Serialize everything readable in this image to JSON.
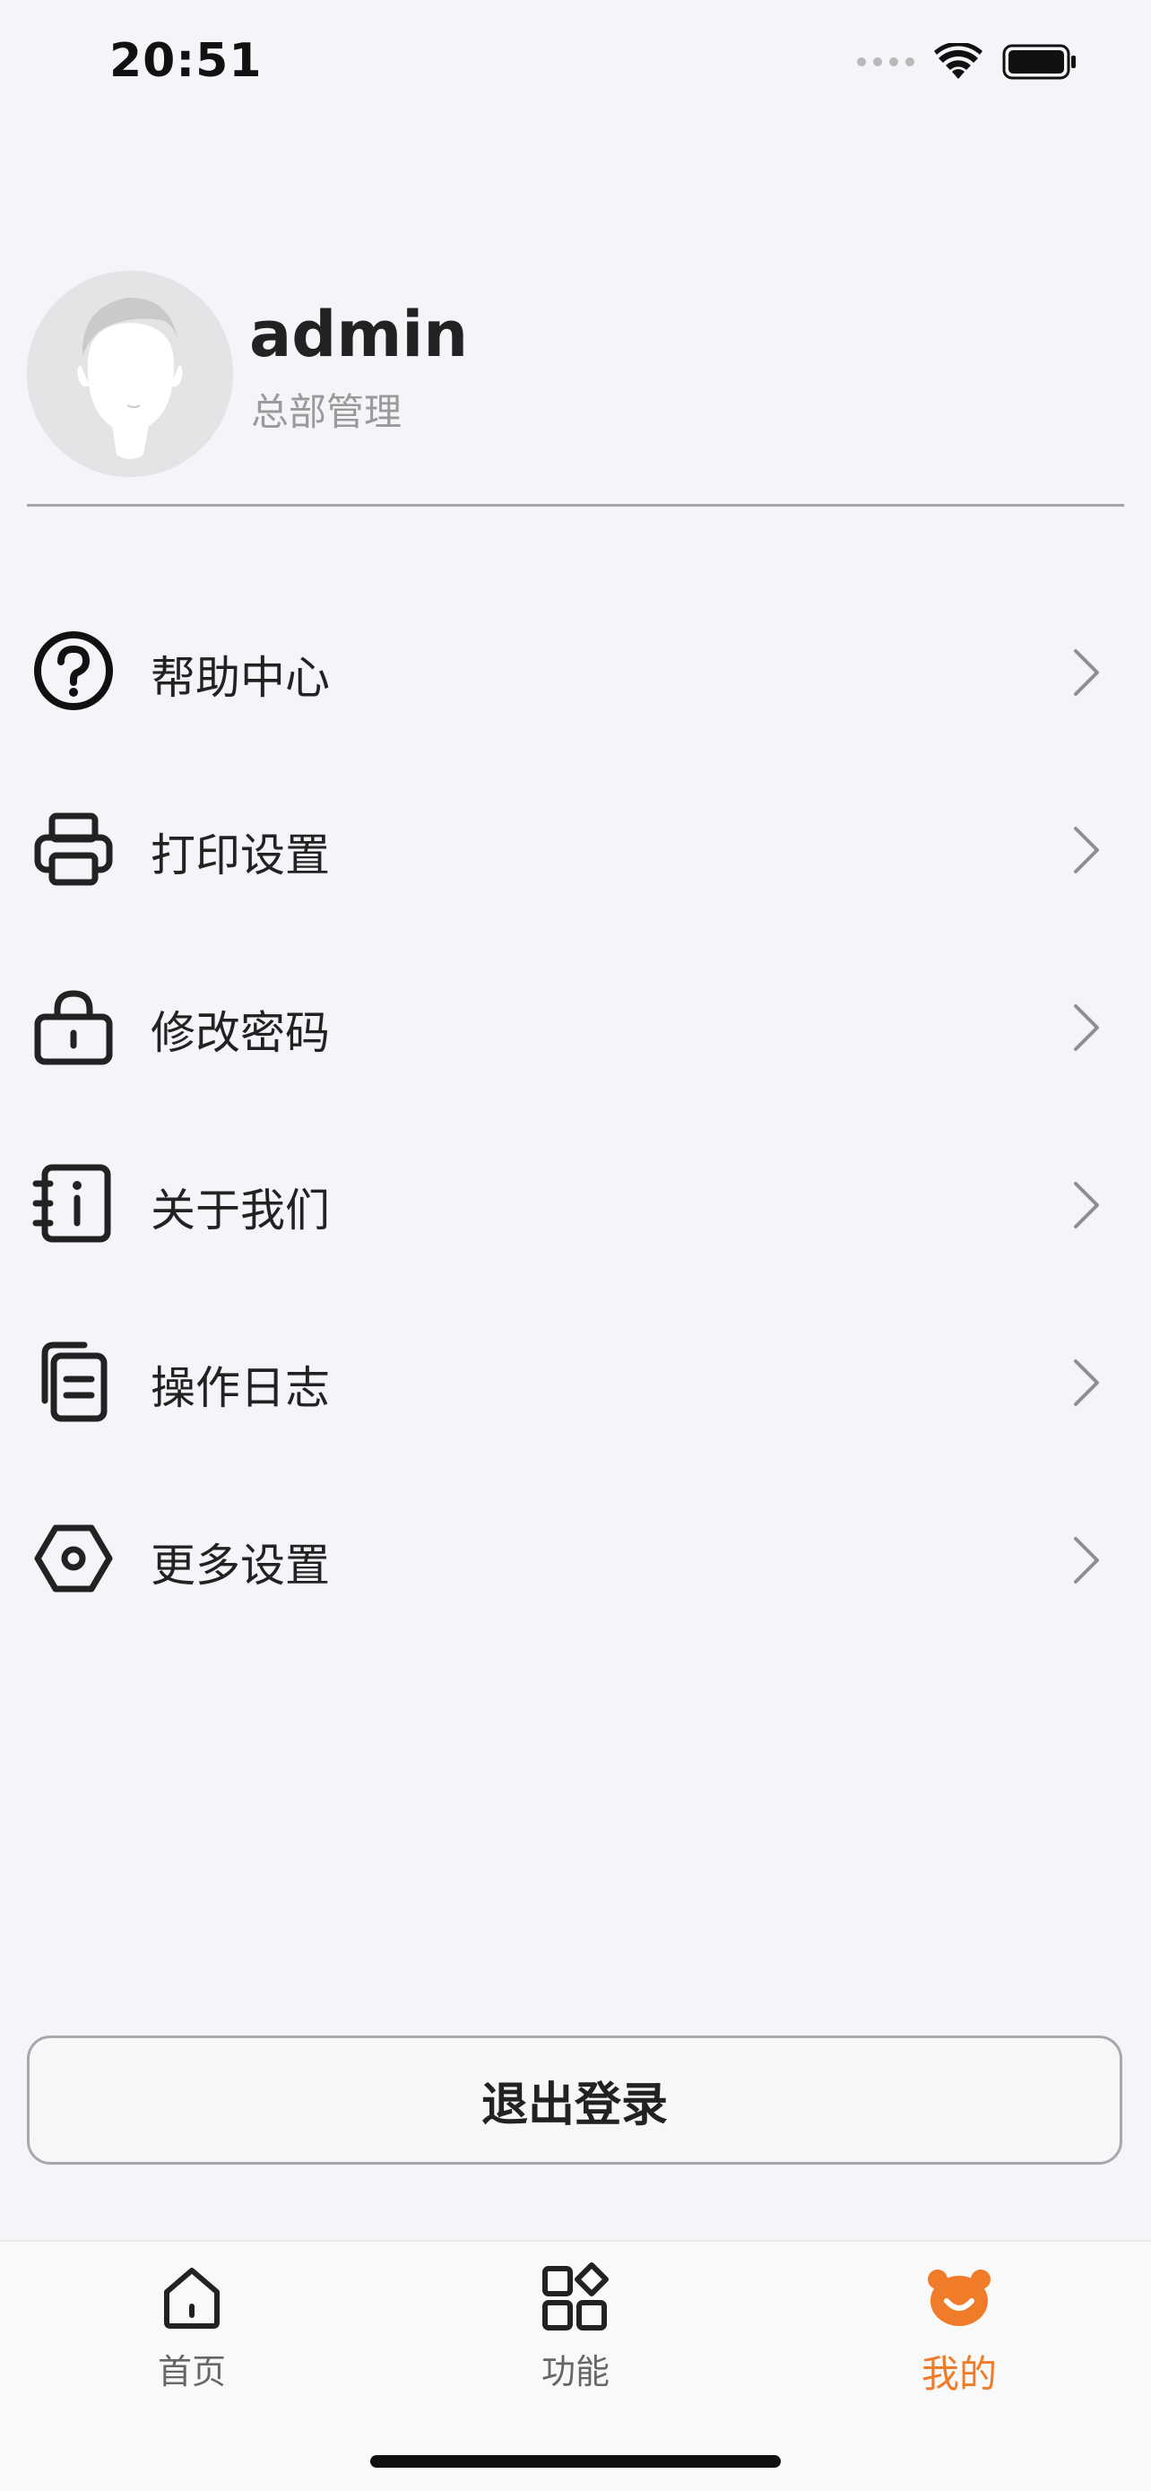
{
  "status_bar": {
    "time": "20:51"
  },
  "profile": {
    "username": "admin",
    "role": "总部管理"
  },
  "menu": {
    "items": [
      {
        "label": "帮助中心",
        "icon": "help-circle-icon"
      },
      {
        "label": "打印设置",
        "icon": "printer-icon"
      },
      {
        "label": "修改密码",
        "icon": "lock-icon"
      },
      {
        "label": "关于我们",
        "icon": "info-notebook-icon"
      },
      {
        "label": "操作日志",
        "icon": "documents-icon"
      },
      {
        "label": "更多设置",
        "icon": "settings-hexagon-icon"
      }
    ]
  },
  "logout": {
    "label": "退出登录"
  },
  "tabbar": {
    "tabs": [
      {
        "label": "首页",
        "icon": "home-icon"
      },
      {
        "label": "功能",
        "icon": "apps-grid-icon"
      },
      {
        "label": "我的",
        "icon": "bear-face-icon"
      }
    ],
    "active_index": 2
  },
  "colors": {
    "background": "#f4f5f8",
    "accent": "#f07b28",
    "text": "#222222",
    "muted": "#9a9a9a"
  }
}
